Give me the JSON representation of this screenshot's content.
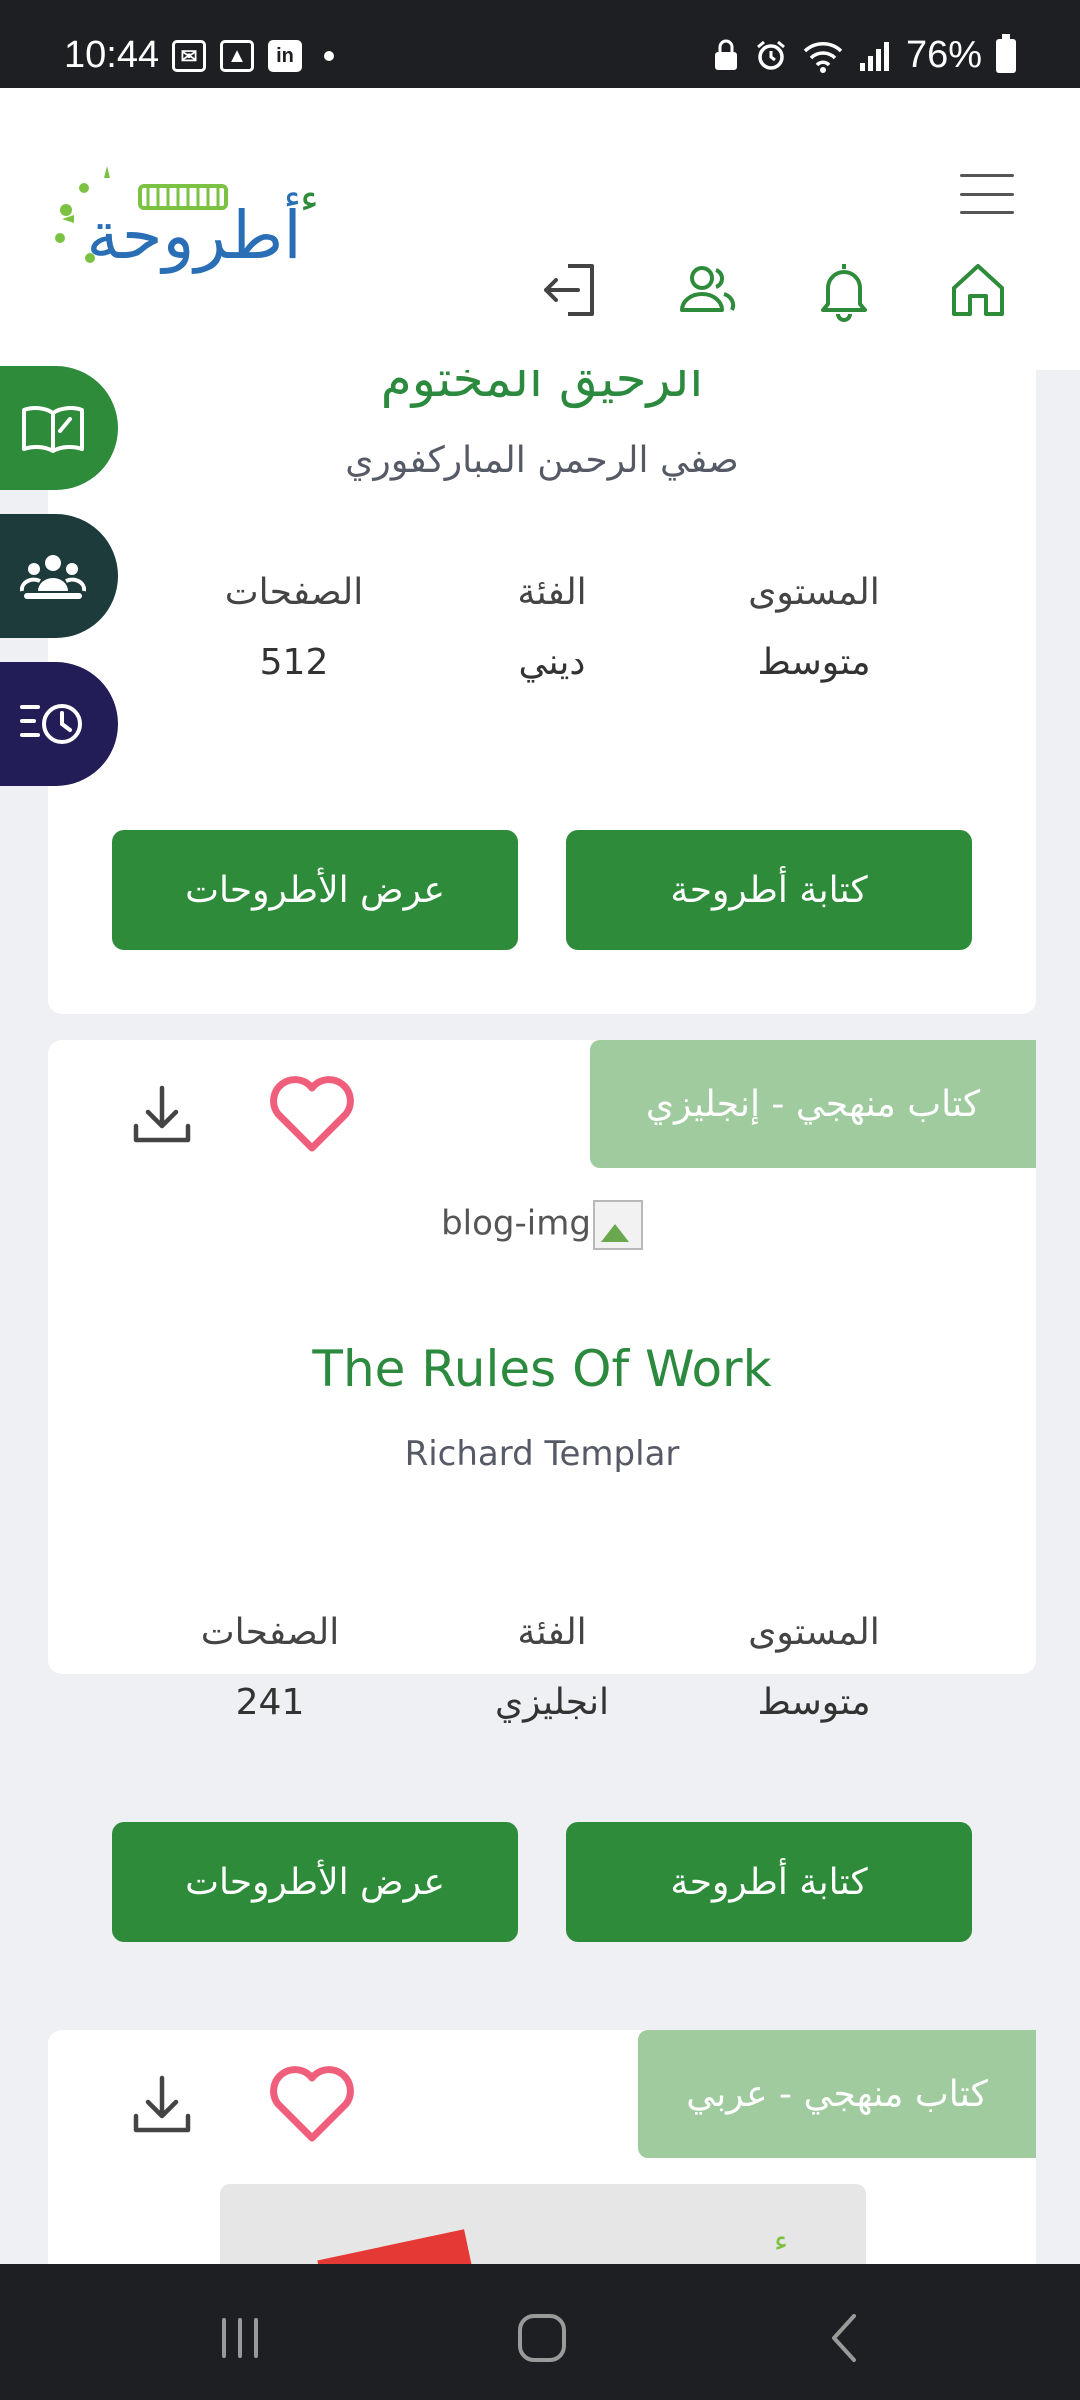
{
  "status_bar": {
    "time": "10:44",
    "battery": "76%",
    "icons_left": [
      "mail-icon",
      "image-icon",
      "linkedin-icon",
      "dot-icon"
    ],
    "icons_right": [
      "lock-icon",
      "alarm-icon",
      "wifi-icon",
      "signal-icon",
      "battery-icon"
    ]
  },
  "header": {
    "logo_text": "أطروحة",
    "nav": [
      "home-icon",
      "bell-icon",
      "users-icon",
      "logout-icon"
    ]
  },
  "side_buttons": [
    "book-icon",
    "group-icon",
    "history-icon"
  ],
  "cards": [
    {
      "title": "الرحيق المختوم",
      "author": "صفي الرحمن المباركفوري",
      "labels": {
        "level": "المستوى",
        "category": "الفئة",
        "pages": "الصفحات"
      },
      "values": {
        "level": "متوسط",
        "category": "ديني",
        "pages": "512"
      },
      "buttons": {
        "write": "كتابة أطروحة",
        "view": "عرض الأطروحات"
      }
    },
    {
      "badge": "كتاب منهجي - إنجليزي",
      "image_alt": "blog-img",
      "title": "The Rules Of Work",
      "author": "Richard Templar",
      "labels": {
        "level": "المستوى",
        "category": "الفئة",
        "pages": "الصفحات"
      },
      "values": {
        "level": "متوسط",
        "category": "انجليزي",
        "pages": "241"
      },
      "buttons": {
        "write": "كتابة أطروحة",
        "view": "عرض الأطروحات"
      }
    },
    {
      "badge": "كتاب منهجي - عربي"
    }
  ],
  "colors": {
    "brand_green": "#2e8b3a",
    "title_green": "#2b8a3e",
    "badge_green": "#9fcb9f",
    "heart": "#ef5f7c"
  }
}
